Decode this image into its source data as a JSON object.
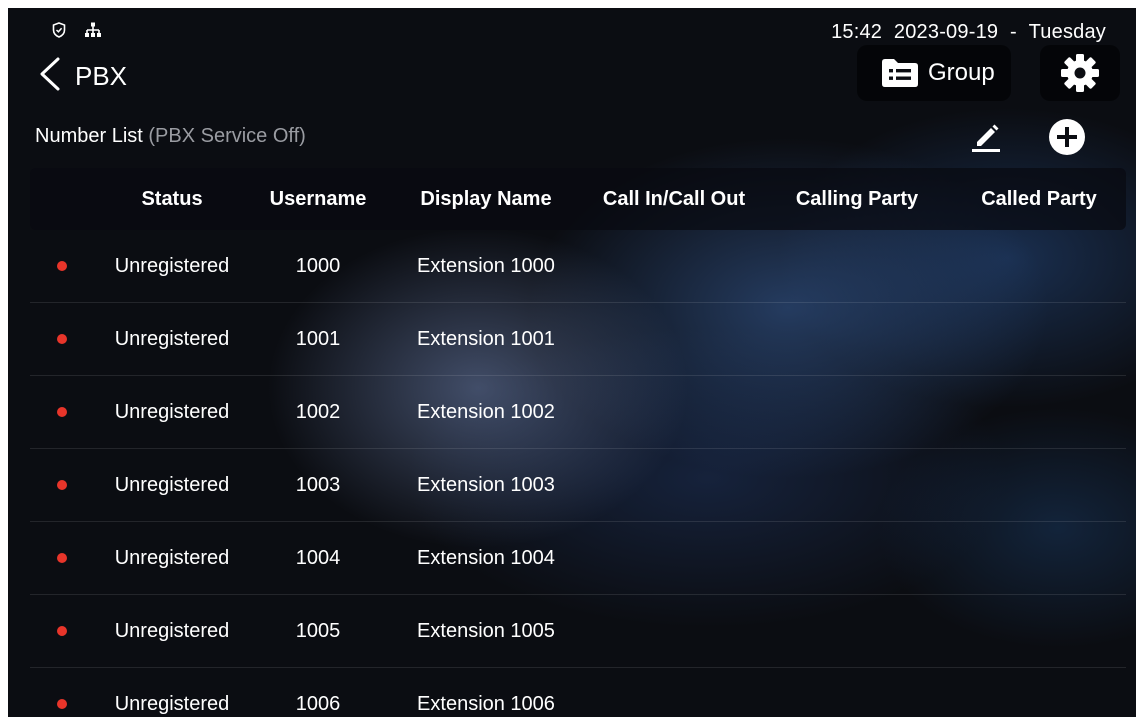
{
  "status_bar": {
    "icons": [
      "shield-icon",
      "network-icon"
    ],
    "time": "15:42",
    "date": "2023-09-19",
    "separator": "-",
    "weekday": "Tuesday"
  },
  "header": {
    "back_icon": "chevron-left-icon",
    "title": "PBX",
    "group_button": {
      "icon": "folder-list-icon",
      "label": "Group"
    },
    "settings_button": {
      "icon": "gear-icon"
    }
  },
  "section": {
    "title": "Number List",
    "subtitle": "(PBX Service Off)",
    "edit_icon": "pencil-icon",
    "add_icon": "plus-circle-icon"
  },
  "table": {
    "columns": [
      "Status",
      "Username",
      "Display Name",
      "Call In/Call Out",
      "Calling Party",
      "Called Party"
    ],
    "rows": [
      {
        "status": "Unregistered",
        "username": "1000",
        "display_name": "Extension 1000",
        "call_direction": "",
        "calling_party": "",
        "called_party": ""
      },
      {
        "status": "Unregistered",
        "username": "1001",
        "display_name": "Extension 1001",
        "call_direction": "",
        "calling_party": "",
        "called_party": ""
      },
      {
        "status": "Unregistered",
        "username": "1002",
        "display_name": "Extension 1002",
        "call_direction": "",
        "calling_party": "",
        "called_party": ""
      },
      {
        "status": "Unregistered",
        "username": "1003",
        "display_name": "Extension 1003",
        "call_direction": "",
        "calling_party": "",
        "called_party": ""
      },
      {
        "status": "Unregistered",
        "username": "1004",
        "display_name": "Extension 1004",
        "call_direction": "",
        "calling_party": "",
        "called_party": ""
      },
      {
        "status": "Unregistered",
        "username": "1005",
        "display_name": "Extension 1005",
        "call_direction": "",
        "calling_party": "",
        "called_party": ""
      },
      {
        "status": "Unregistered",
        "username": "1006",
        "display_name": "Extension 1006",
        "call_direction": "",
        "calling_party": "",
        "called_party": ""
      }
    ]
  },
  "colors": {
    "background": "#0b0d12",
    "status_dot_unregistered": "#e8352a",
    "subtitle_gray": "#9a9ca2",
    "text": "#ffffff"
  }
}
